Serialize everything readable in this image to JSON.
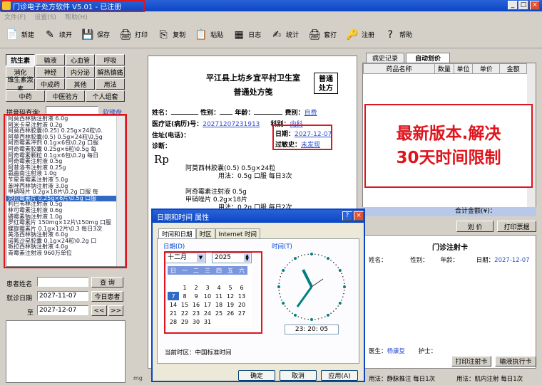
{
  "window": {
    "title": "门诊电子处方软件 V5.01 - 已注册",
    "min": "_",
    "max": "□",
    "close": "×"
  },
  "menu": [
    "文件(F)",
    "设置(S)",
    "帮助(H)"
  ],
  "toolbar": [
    {
      "label": "新建",
      "icon": "new-doc-icon",
      "glyph": "📄"
    },
    {
      "label": "续开",
      "icon": "continue-icon",
      "glyph": "✎"
    },
    {
      "label": "保存",
      "icon": "save-icon",
      "glyph": "💾"
    },
    {
      "label": "打印",
      "icon": "print-icon",
      "glyph": "🖨"
    },
    {
      "label": "复制",
      "icon": "copy-icon",
      "glyph": "⎘"
    },
    {
      "label": "粘贴",
      "icon": "paste-icon",
      "glyph": "📋"
    },
    {
      "label": "日志",
      "icon": "log-icon",
      "glyph": "▦"
    },
    {
      "label": "统计",
      "icon": "stats-icon",
      "glyph": "✍"
    },
    {
      "label": "套打",
      "icon": "template-print-icon",
      "glyph": "🖨"
    },
    {
      "label": "注册",
      "icon": "register-icon",
      "glyph": "🔑"
    },
    {
      "label": "帮助",
      "icon": "help-icon",
      "glyph": "?"
    }
  ],
  "categories": [
    [
      "抗生素",
      "输液",
      "心血管",
      "呼吸"
    ],
    [
      "消化",
      "神经",
      "内分泌",
      "解热镇痛"
    ],
    [
      "维生素激素",
      "中成药",
      "其他",
      "用法"
    ],
    [
      "中药",
      "中医验方",
      "个人组套"
    ]
  ],
  "search": {
    "label": "拼音码查询:",
    "value": "",
    "keyboard": "软键盘"
  },
  "druglist": [
    "阿莫西林钠注射液 6.0g",
    "阿米卡星注射液 0.2g",
    "阿莫西林胶囊(0.25) 0.25g×24粒\\0.",
    "阿莫西林胶囊(0.5) 0.5g×24粒\\0.5g",
    "阿奇霉素冲剂 0.1g×6包\\0.2g 口服",
    "阿奇霉素胶囊 0.25g×6粒\\0.5g 每",
    "阿奇霉素颗粒 0.1g×6包\\0.2g 每日",
    "阿奇霉素注射液 0.5g",
    "阿昔洛韦注射液 0.25g",
    "氨曲南注射液 1.0g",
    "苄星青霉素注射液 5.0g",
    "苯唑西林钠注射液 3.0g",
    "甲硝唑片 0.2g×18片\\0.2g 口服 每",
    "克拉霉素片 0.25g×6片\\0.5g 口服",
    "利巴韦林注射液 0.5g",
    "林可霉素注射液 0.6g",
    "磷霉素钠注射液 1.0g",
    "罗红霉素片 150mg×12片\\150mg 口服",
    "螺旋霉素片 0.1g×12片\\0.3 每日3次",
    "美洛西林钠注射液 6.0g",
    "诺氟沙星胶囊 0.1g×24粒\\0.2g 口",
    "哌拉西林钠注射液 4.0g",
    "青霉素注射液 960万单位"
  ],
  "patient": {
    "name_label": "患者姓名",
    "search_btn": "查 询",
    "date_label": "就诊日期",
    "date_from": "2027-11-07",
    "today_btn": "今日患者",
    "to_label": "至",
    "date_to": "2027-12-07",
    "prev": "<<",
    "next": ">>"
  },
  "prescription": {
    "hospital": "平江县上坊乡宜平村卫生室",
    "title": "普通处方笺",
    "badge1": "普通",
    "badge2": "处方",
    "name": "姓名：",
    "sex": "性别：",
    "age": "年龄：",
    "fee_label": "费别：",
    "fee": "自费",
    "card_label": "医疗证(病历)号：",
    "card": "20271207231913",
    "dept_label": "科别：",
    "dept": "内科",
    "phone": "住址(电话)：",
    "date_label": "日期：",
    "date": "2027-12-07",
    "allergy_label": "过敏史：",
    "allergy": "未发现",
    "diag": "诊断：",
    "rp": "Rp",
    "items": [
      {
        "drug": "阿莫西林胶囊(0.5)  0.5g×24粒",
        "usage": "用法：0.5g 口服 每日3次"
      },
      {
        "drug": "阿奇霉素注射液  0.5g",
        "usage": ""
      },
      {
        "drug": "甲硝唑片  0.2g×18片",
        "usage": "用法：0.2g 口服 每日2次"
      }
    ]
  },
  "rightpanel": {
    "tab1": "病史记录",
    "tab2": "自动划价",
    "cols": [
      "药品名称",
      "数量",
      "单位",
      "单价",
      "金额"
    ],
    "total": "合计金额(¥)：",
    "price_btn": "划 价",
    "print_btn": "打印票据"
  },
  "promo": {
    "line1": "最新版本.解决",
    "line2": "30天时间限制"
  },
  "injection": {
    "title": "门诊注射卡",
    "name": "姓名：",
    "sex": "性别：",
    "age": "年龄：",
    "date_label": "日期：",
    "date": "2027-12-07",
    "doctor_label": "医生：",
    "doctor": "杨康复",
    "nurse": "护士：",
    "print_btn": "打印注射卡",
    "infusion_btn": "输液执行卡"
  },
  "statusbar": {
    "left": "mg",
    "u1": "用法：静脉推注 每日1次",
    "u2": "用法：肌内注射 每日1次"
  },
  "dialog": {
    "title": "日期和时间 属性",
    "help": "?",
    "close": "×",
    "tabs": [
      "时间和日期",
      "时区",
      "Internet 时间"
    ],
    "date_label": "日期(D)",
    "month": "十二月",
    "year": "2025",
    "time_label": "时间(T)",
    "weekdays": [
      "日",
      "一",
      "二",
      "三",
      "四",
      "五",
      "六"
    ],
    "days": [
      [
        "",
        "",
        "",
        "",
        "",
        "",
        ""
      ],
      [
        "",
        "1",
        "2",
        "3",
        "4",
        "5",
        "6"
      ],
      [
        "7",
        "8",
        "9",
        "10",
        "11",
        "12",
        "13"
      ],
      [
        "14",
        "15",
        "16",
        "17",
        "18",
        "19",
        "20"
      ],
      [
        "21",
        "22",
        "23",
        "24",
        "25",
        "26",
        "27"
      ],
      [
        "28",
        "29",
        "30",
        "31",
        "",
        "",
        ""
      ]
    ],
    "selected_day": "7",
    "time": "23: 20: 05",
    "tz_label": "当前时区：",
    "tz": "中国标准时间",
    "ok": "确定",
    "cancel": "取消",
    "apply": "应用(A)"
  }
}
